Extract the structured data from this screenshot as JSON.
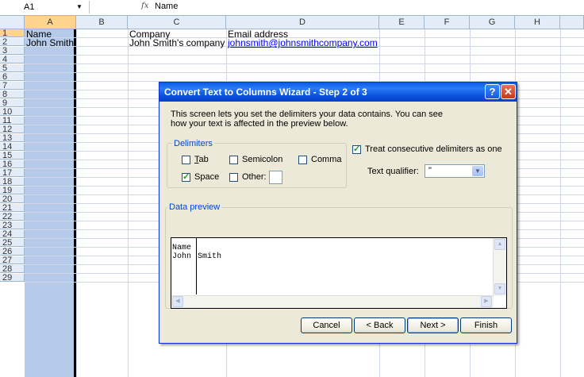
{
  "formula_bar": {
    "cell_ref": "A1",
    "fx": "fx",
    "value": "Name"
  },
  "columns": [
    "A",
    "B",
    "C",
    "D",
    "E",
    "F",
    "G",
    "H"
  ],
  "rows": [
    "1",
    "2",
    "3",
    "4",
    "5",
    "6",
    "7",
    "8",
    "9",
    "10",
    "11",
    "12",
    "13",
    "14",
    "15",
    "16",
    "17",
    "18",
    "19",
    "20",
    "21",
    "22",
    "23",
    "24",
    "25",
    "26",
    "27",
    "28",
    "29"
  ],
  "cells": {
    "a1": "Name",
    "a2": "John Smith",
    "c1": "Company",
    "c2": "John Smith's company",
    "d1": "Email address",
    "d2": "johnsmith@johnsmithcompany.com"
  },
  "dialog": {
    "title": "Convert Text to Columns Wizard - Step 2 of 3",
    "help": "?",
    "close": "✕",
    "desc1": "This screen lets you set the delimiters your data contains.  You can see",
    "desc2": "how your text is affected in the preview below.",
    "delimiters_legend": "Delimiters",
    "tab": "Tab",
    "semicolon": "Semicolon",
    "comma": "Comma",
    "space": "Space",
    "other": "Other:",
    "consecutive": "Treat consecutive delimiters as one",
    "qualifier_label": "Text qualifier:",
    "qualifier_value": "\"",
    "preview_legend": "Data preview",
    "preview_rows": [
      [
        "Name",
        ""
      ],
      [
        "John",
        "Smith"
      ]
    ],
    "cancel": "Cancel",
    "back": "< Back",
    "next": "Next >",
    "finish": "Finish"
  },
  "checked": {
    "tab": false,
    "semicolon": false,
    "comma": false,
    "space": true,
    "other": false,
    "consecutive": true
  }
}
